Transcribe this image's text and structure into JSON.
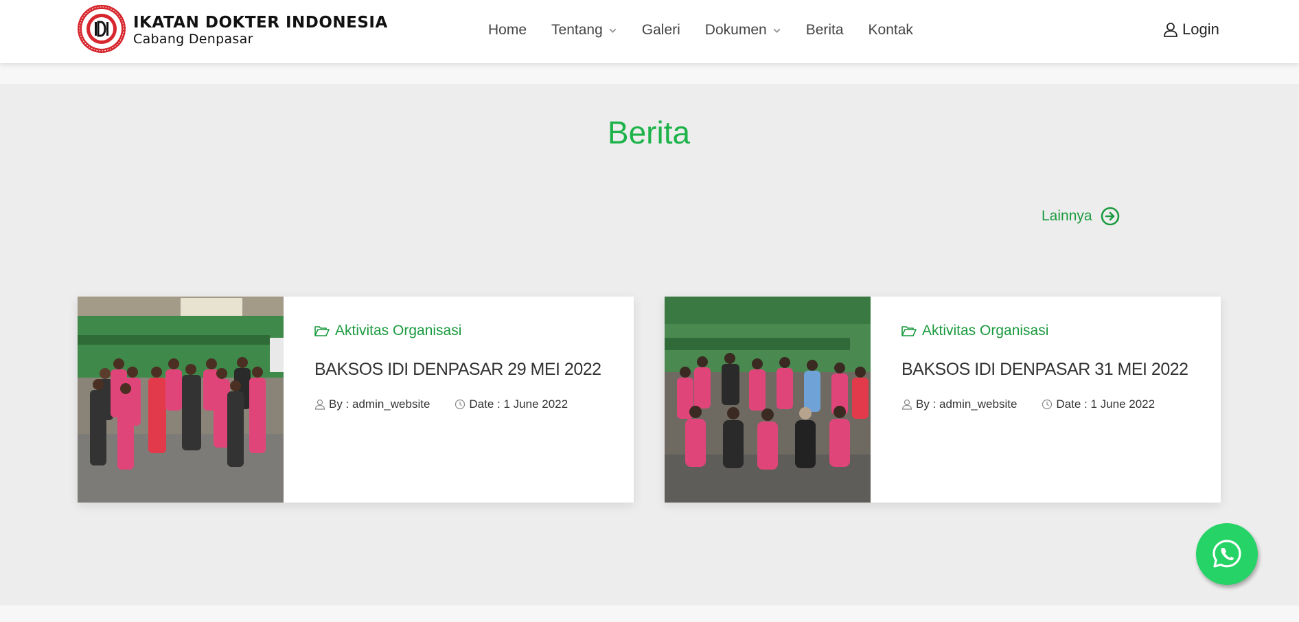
{
  "brand": {
    "title": "IKATAN DOKTER INDONESIA",
    "subtitle": "Cabang Denpasar",
    "logo_ring_text": "IKATAN DOKTER INDONESIA",
    "logo_bottom_text": "CABANG DENPASAR",
    "logo_center_text": "IDI"
  },
  "nav": {
    "items": [
      {
        "label": "Home",
        "has_dropdown": false
      },
      {
        "label": "Tentang",
        "has_dropdown": true
      },
      {
        "label": "Galeri",
        "has_dropdown": false
      },
      {
        "label": "Dokumen",
        "has_dropdown": true
      },
      {
        "label": "Berita",
        "has_dropdown": false
      },
      {
        "label": "Kontak",
        "has_dropdown": false
      }
    ],
    "login_label": "Login",
    "login_icon": "user-icon"
  },
  "section": {
    "title": "Berita",
    "more_label": "Lainnya",
    "more_icon": "arrow-circle-right-icon"
  },
  "posts": [
    {
      "category": "Aktivitas Organisasi",
      "title": "BAKSOS IDI DENPASAR 29 MEI 2022",
      "author": "By : admin_website",
      "date": "Date : 1 June 2022",
      "image": "group-photo"
    },
    {
      "category": "Aktivitas Organisasi",
      "title": "BAKSOS IDI DENPASAR 31 MEI 2022",
      "author": "By : admin_website",
      "date": "Date : 1 June 2022",
      "image": "group-photo"
    }
  ],
  "colors": {
    "accent_green": "#1db34a",
    "link_green": "#1a9a3e",
    "whatsapp_green": "#25d366",
    "logo_red": "#d7262d",
    "section_bg": "#ededed"
  },
  "whatsapp": {
    "icon": "whatsapp-icon"
  }
}
